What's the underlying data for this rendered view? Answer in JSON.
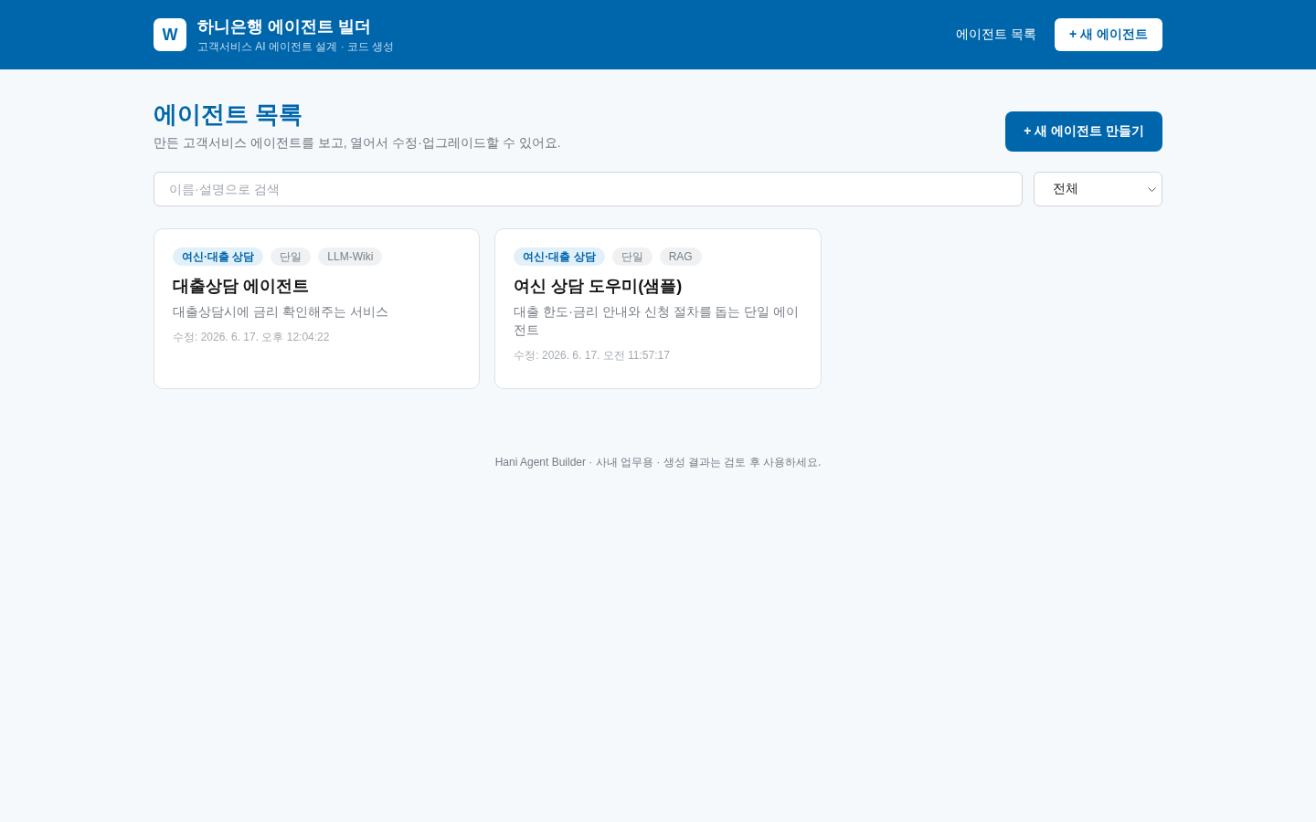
{
  "header": {
    "logo": "W",
    "title": "하니은행 에이전트 빌더",
    "subtitle": "고객서비스 AI 에이전트 설계 · 코드 생성",
    "nav": [
      {
        "label": "에이전트 목록",
        "kind": "link"
      },
      {
        "label": "+ 새 에이전트",
        "kind": "button"
      }
    ]
  },
  "page": {
    "title": "에이전트 목록",
    "description": "만든 고객서비스 에이전트를 보고, 열어서 수정·업그레이드할 수 있어요.",
    "create_button": "+ 새 에이전트 만들기"
  },
  "filters": {
    "search": {
      "placeholder": "이름·설명으로 검색"
    },
    "category": {
      "value": "전체"
    }
  },
  "agents": [
    {
      "tags": [
        {
          "label": "여신·대출 상담",
          "kind": "category"
        },
        {
          "label": "단일",
          "kind": "plain"
        },
        {
          "label": "LLM-Wiki",
          "kind": "plain"
        }
      ],
      "name": "대출상담 에이전트",
      "description": "대출상담시에 금리 확인해주는 서비스",
      "modified": "수정: 2026. 6. 17. 오후 12:04:22"
    },
    {
      "tags": [
        {
          "label": "여신·대출 상담",
          "kind": "category"
        },
        {
          "label": "단일",
          "kind": "plain"
        },
        {
          "label": "RAG",
          "kind": "plain"
        }
      ],
      "name": "여신 상담 도우미(샘플)",
      "description": "대출 한도·금리 안내와 신청 절차를 돕는 단일 에이전트",
      "modified": "수정: 2026. 6. 17. 오전 11:57:17"
    }
  ],
  "footer": "Hani Agent Builder · 사내 업무용 · 생성 결과는 검토 후 사용하세요."
}
